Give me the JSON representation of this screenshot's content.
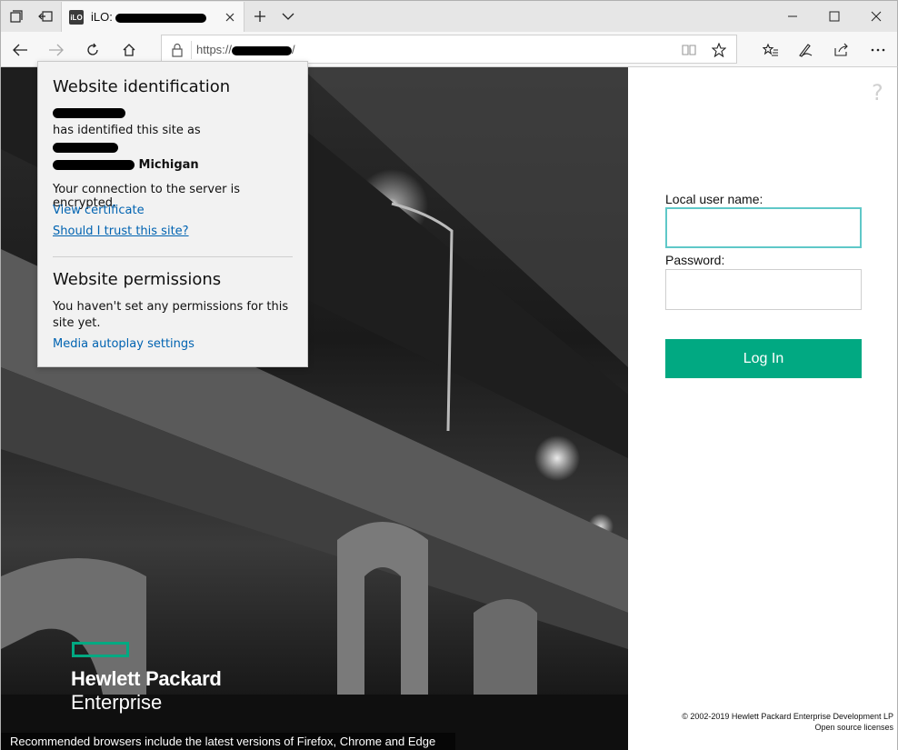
{
  "browser": {
    "tab": {
      "favicon_text": "iLO",
      "title_prefix": "iLO:"
    },
    "url": "https://",
    "url_suffix": "/",
    "icons": {
      "back": "arrow-left-icon",
      "forward": "arrow-right-icon",
      "refresh": "refresh-icon",
      "home": "home-icon",
      "lock": "lock-icon",
      "reading_view": "book-icon",
      "favorite": "star-icon",
      "favorites_hub": "favorites-list-icon",
      "notes": "pen-icon",
      "share": "share-icon",
      "more": "more-icon",
      "new_tab": "plus-icon",
      "tab_list": "chevron-down-icon",
      "minimize": "minimize-icon",
      "maximize": "maximize-icon",
      "close": "close-icon"
    }
  },
  "popup": {
    "heading1": "Website identification",
    "identified_text": "has identified this site as",
    "location_suffix": "Michigan",
    "encrypted_text": "Your connection to the server is encrypted.",
    "view_cert": "View certificate",
    "trust_link": "Should I trust this site?",
    "heading2": "Website permissions",
    "permissions_line1": "You haven't set any permissions for this",
    "permissions_line2": "site yet.",
    "media_link": "Media autoplay settings"
  },
  "login": {
    "help_glyph": "?",
    "username_label": "Local user name:",
    "password_label": "Password:",
    "login_button": "Log In",
    "copyright": "© 2002-2019 Hewlett Packard Enterprise Development LP",
    "open_source": "Open source licenses",
    "accent_color": "#01a982"
  },
  "hero": {
    "brand_line1": "Hewlett Packard",
    "brand_line2": "Enterprise",
    "browser_note": "Recommended browsers include the latest versions of Firefox, Chrome and Edge"
  }
}
